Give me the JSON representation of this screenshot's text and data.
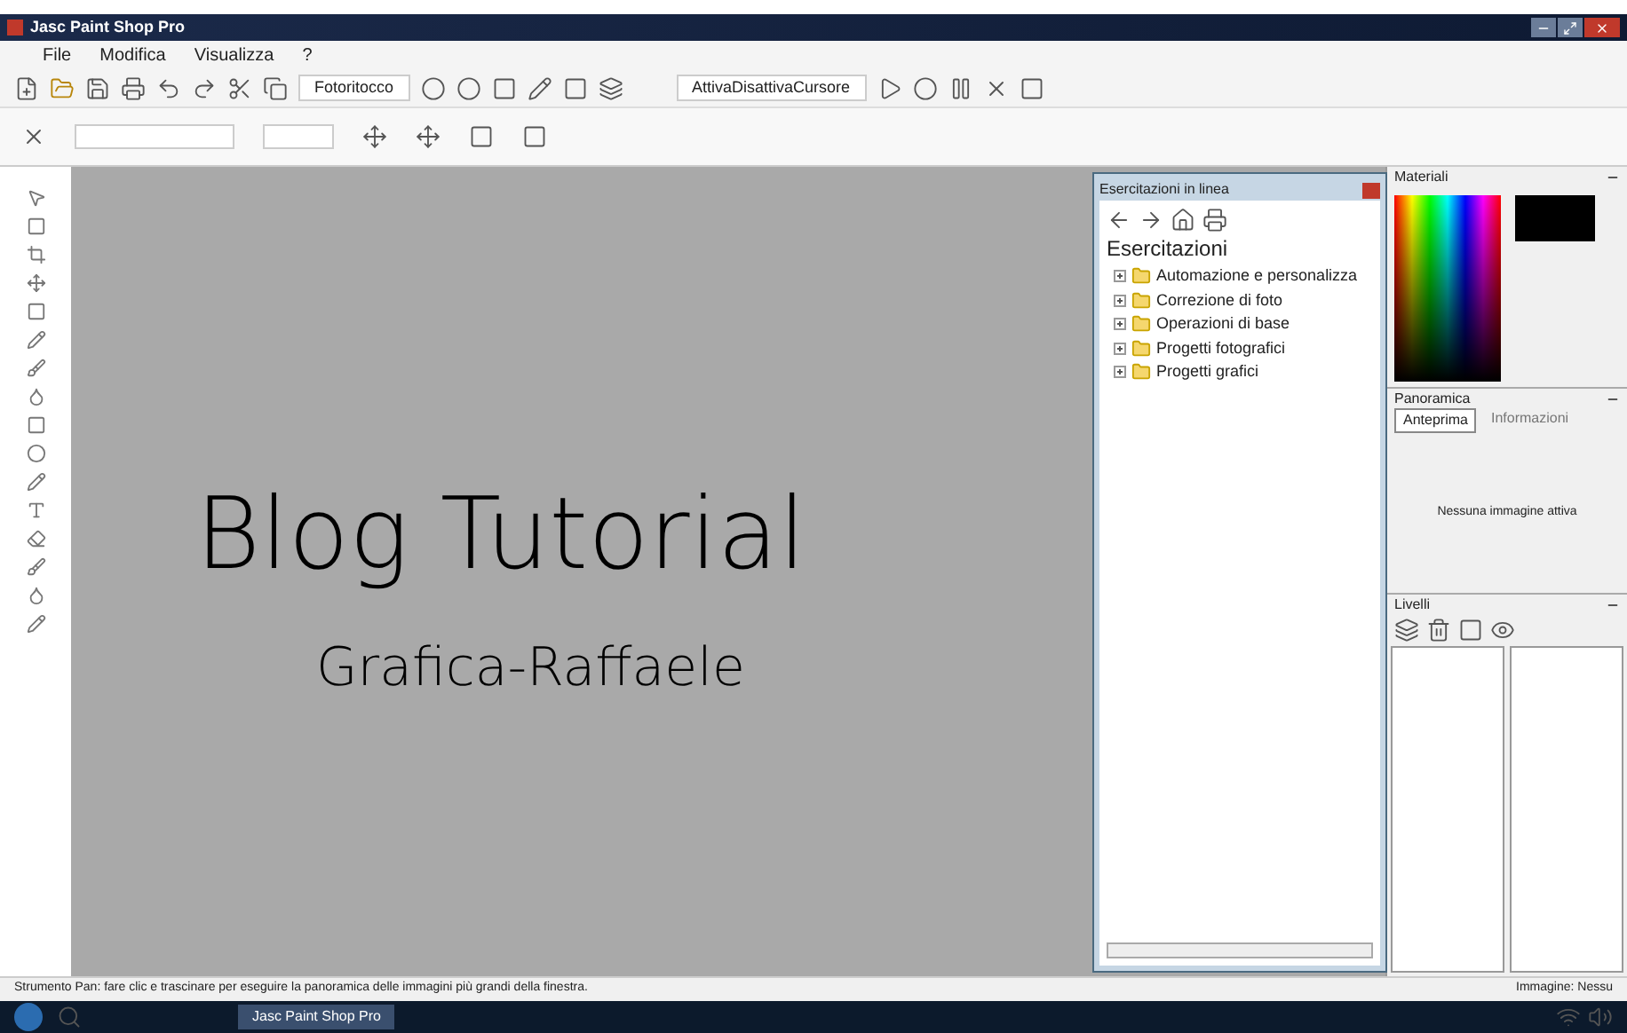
{
  "window": {
    "title": "Jasc Paint Shop Pro"
  },
  "menu": [
    {
      "label": "File"
    },
    {
      "label": "Modifica"
    },
    {
      "label": "Visualizza"
    },
    {
      "label": "?"
    }
  ],
  "toolbar": {
    "preset_dropdown": "Fotoritocco",
    "script_dropdown": "AttivaDisattivaCursore"
  },
  "canvas": {
    "heading": "Blog Tutorial",
    "subheading": "Grafica-Raffaele"
  },
  "learning_center": {
    "title": "Esercitazioni in linea",
    "heading": "Esercitazioni",
    "items": [
      {
        "label": "Automazione e personalizza",
        "expanded": false
      },
      {
        "label": "Correzione di foto",
        "expanded": false
      },
      {
        "label": "Operazioni di base",
        "expanded": false
      },
      {
        "label": "Progetti fotografici",
        "expanded": false
      },
      {
        "label": "Progetti grafici",
        "expanded": false
      }
    ]
  },
  "materials": {
    "title": "Materiali"
  },
  "overview": {
    "title": "Panoramica",
    "tabs": [
      {
        "label": "Anteprima",
        "selected": true
      },
      {
        "label": "Informazioni",
        "selected": false
      }
    ],
    "message": "Nessuna immagine attiva"
  },
  "layers": {
    "title": "Livelli"
  },
  "status_bar": {
    "hint": "Strumento Pan: fare clic e trascinare per eseguire la panoramica delle immagini più grandi della finestra.",
    "image_info": "Immagine: Nessu"
  },
  "taskbar": {
    "apps": [
      {
        "label": "Jasc Paint Shop Pro",
        "selected": true
      }
    ]
  }
}
